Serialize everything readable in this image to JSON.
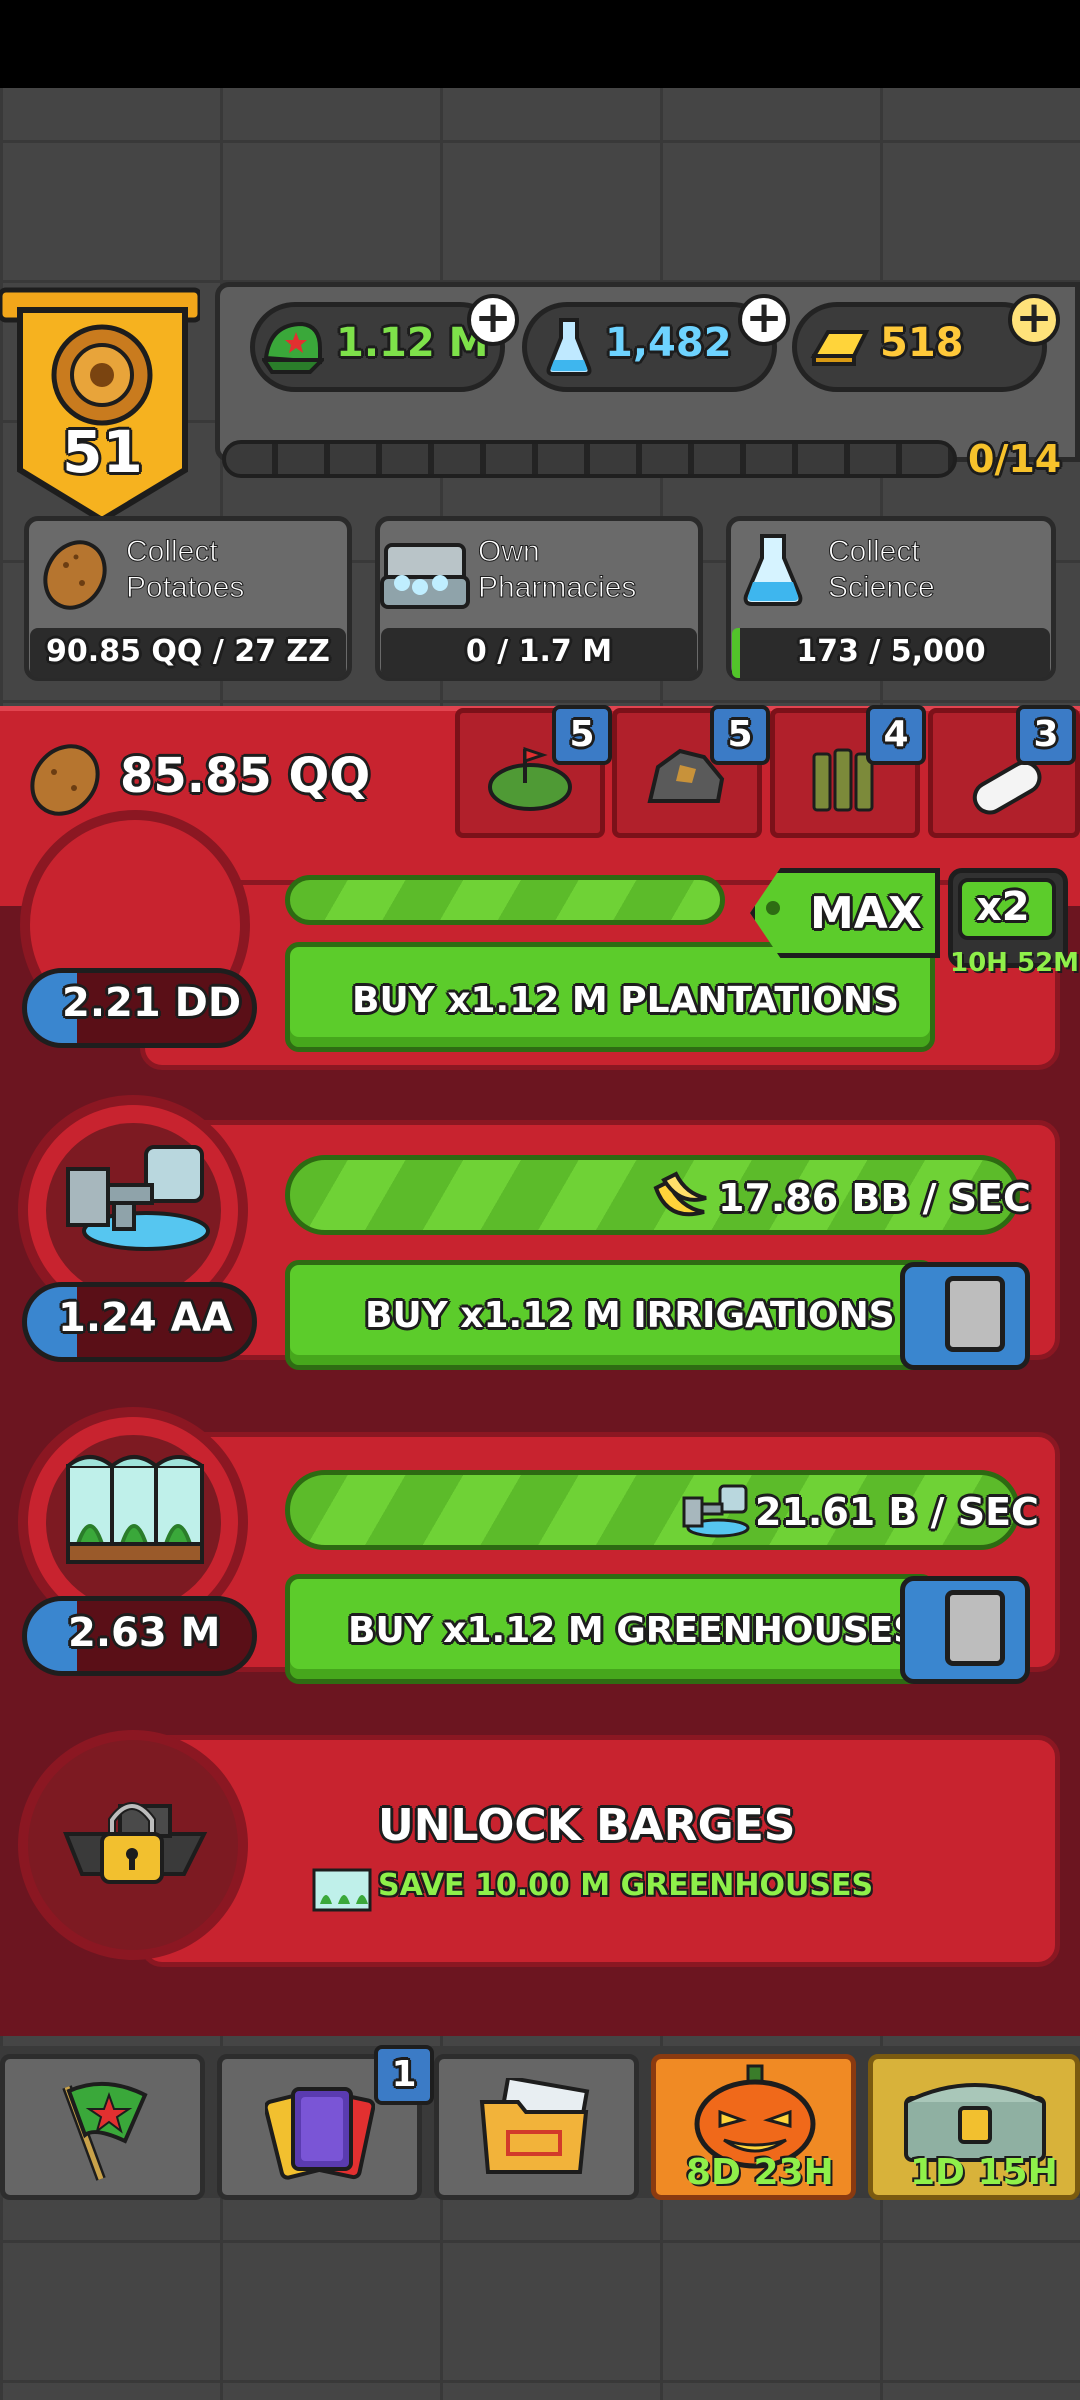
{
  "header": {
    "level": "51",
    "resources": [
      {
        "name": "potato-bucks",
        "value": "1.12 M",
        "color": "#7ee14a"
      },
      {
        "name": "science",
        "value": "1,482",
        "color": "#6ed3ff"
      },
      {
        "name": "gold",
        "value": "518",
        "color": "#ffc93a"
      }
    ],
    "level_progress": "0/14",
    "level_progress_fraction": 0
  },
  "goals": [
    {
      "title_line1": "Collect",
      "title_line2": "Potatoes",
      "value": "90.85 QQ / 27 ZZ",
      "icon": "potato-icon"
    },
    {
      "title_line1": "Own",
      "title_line2": "Pharmacies",
      "value": "0 / 1.7 M",
      "icon": "pharmacy-icon"
    },
    {
      "title_line1": "Collect",
      "title_line2": "Science",
      "value": "173 / 5,000",
      "icon": "science-flask-icon"
    }
  ],
  "resource_bar": {
    "potatoes": "85.85 QQ",
    "tabs": [
      {
        "icon": "plantation-icon",
        "badge": "5"
      },
      {
        "icon": "ore-rock-icon",
        "badge": "5"
      },
      {
        "icon": "ammo-icon",
        "badge": "4"
      },
      {
        "icon": "pill-icon",
        "badge": "3"
      }
    ]
  },
  "controls": {
    "max_label": "MAX",
    "boost_label": "x2",
    "boost_timer": "10H 52M"
  },
  "rows": [
    {
      "count": "2.21 DD",
      "buy_label": "BUY x1.12 M PLANTATIONS"
    },
    {
      "count": "1.24 AA",
      "production": "17.86 BB / SEC",
      "buy_label": "BUY x1.12 M IRRIGATIONS"
    },
    {
      "count": "2.63 M",
      "production": "21.61 B / SEC",
      "buy_label": "BUY x1.12 M GREENHOUSES"
    }
  ],
  "unlock": {
    "title": "UNLOCK BARGES",
    "requirement": "SAVE 10.00 M GREENHOUSES"
  },
  "bottom_nav": {
    "cards_badge": "1",
    "event_timer": "8D 23H",
    "chest_timer": "1D 15H"
  }
}
